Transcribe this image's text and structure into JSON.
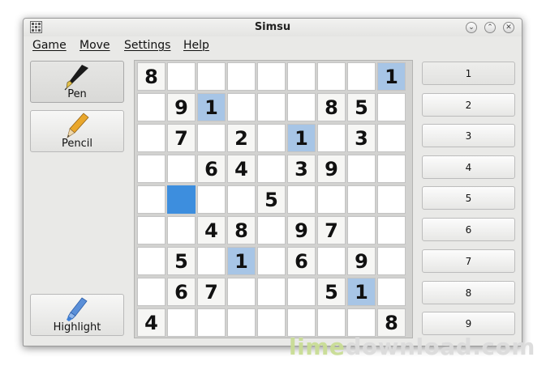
{
  "window": {
    "title": "Simsu"
  },
  "titlebar": {
    "minimize_glyph": "⌄",
    "maximize_glyph": "⌃",
    "close_glyph": "✕"
  },
  "menu": [
    "Game",
    "Move",
    "Settings",
    "Help"
  ],
  "tools": [
    {
      "label": "Pen",
      "icon": "pen-icon",
      "active": true
    },
    {
      "label": "Pencil",
      "icon": "pencil-icon",
      "active": false
    },
    {
      "label": "Highlight",
      "icon": "highlighter-icon",
      "active": false
    }
  ],
  "board": {
    "rows": [
      [
        "8",
        "",
        "",
        "",
        "",
        "",
        "",
        "",
        "1"
      ],
      [
        "",
        "9",
        "1",
        "",
        "",
        "",
        "8",
        "5",
        ""
      ],
      [
        "",
        "7",
        "",
        "2",
        "",
        "1",
        "",
        "3",
        ""
      ],
      [
        "",
        "",
        "6",
        "4",
        "",
        "3",
        "9",
        "",
        ""
      ],
      [
        "",
        "",
        "",
        "",
        "5",
        "",
        "",
        "",
        ""
      ],
      [
        "",
        "",
        "4",
        "8",
        "",
        "9",
        "7",
        "",
        ""
      ],
      [
        "",
        "5",
        "",
        "1",
        "",
        "6",
        "",
        "9",
        ""
      ],
      [
        "",
        "6",
        "7",
        "",
        "",
        "",
        "5",
        "1",
        ""
      ],
      [
        "4",
        "",
        "",
        "",
        "",
        "",
        "",
        "",
        "8"
      ]
    ],
    "given": [
      [
        1,
        0,
        0,
        0,
        0,
        0,
        0,
        0,
        0
      ],
      [
        0,
        1,
        0,
        0,
        0,
        0,
        1,
        1,
        0
      ],
      [
        0,
        1,
        0,
        1,
        0,
        0,
        0,
        1,
        0
      ],
      [
        0,
        0,
        1,
        1,
        0,
        1,
        1,
        0,
        0
      ],
      [
        0,
        0,
        0,
        0,
        1,
        0,
        0,
        0,
        0
      ],
      [
        0,
        0,
        1,
        1,
        0,
        1,
        1,
        0,
        0
      ],
      [
        0,
        1,
        0,
        0,
        0,
        1,
        0,
        1,
        0
      ],
      [
        0,
        1,
        1,
        0,
        0,
        0,
        1,
        0,
        0
      ],
      [
        1,
        0,
        0,
        0,
        0,
        0,
        0,
        0,
        1
      ]
    ],
    "highlighted_digit": "1",
    "selected_cell": {
      "row": 4,
      "col": 1
    },
    "colors": {
      "highlight": "#a7c5e6",
      "selected": "#3d8ede"
    }
  },
  "number_buttons": [
    "1",
    "2",
    "3",
    "4",
    "5",
    "6",
    "7",
    "8",
    "9"
  ],
  "active_number": "1",
  "watermark": {
    "part1": "lime",
    "part2": "download.com"
  }
}
